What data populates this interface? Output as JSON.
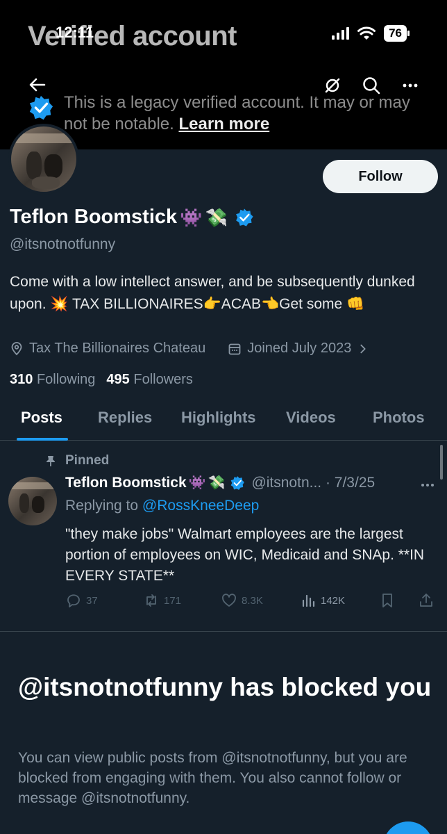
{
  "status_bar": {
    "time": "12:11",
    "battery": "76"
  },
  "header": {
    "ghost_title": "Verified account",
    "legacy_text": "This is a legacy verified account. It may or may not be notable.",
    "learn_more": "Learn more"
  },
  "profile": {
    "follow_label": "Follow",
    "display_name": "Teflon Boomstick",
    "name_emojis": [
      "👾",
      "💸"
    ],
    "handle": "@itsnotnotfunny",
    "bio": "Come with a low intellect answer, and be subsequently dunked upon.  💥 TAX BILLIONAIRES👉ACAB👈Get some 👊",
    "location": "Tax The Billionaires Chateau",
    "joined": "Joined July 2023",
    "following_count": "310",
    "following_label": "Following",
    "followers_count": "495",
    "followers_label": "Followers"
  },
  "tabs": [
    {
      "label": "Posts",
      "active": true
    },
    {
      "label": "Replies"
    },
    {
      "label": "Highlights"
    },
    {
      "label": "Videos"
    },
    {
      "label": "Photos"
    }
  ],
  "post": {
    "pinned_label": "Pinned",
    "author_name": "Teflon Boomstick",
    "handle_date": "@itsnotn... · 7/3/25",
    "replying_prefix": "Replying to",
    "replying_to": "@RossKneeDeep",
    "text": "\"they make jobs\" Walmart employees are the largest portion of employees on WIC, Medicaid and SNAp. **IN EVERY STATE**",
    "replies": "37",
    "reposts": "171",
    "likes": "8.3K",
    "views": "142K"
  },
  "blocked": {
    "title": "@itsnotnotfunny has blocked you",
    "text": "You can view public posts from @itsnotnotfunny, but you are blocked from engaging with them. You also cannot follow or message @itsnotnotfunny."
  },
  "colors": {
    "accent": "#1d9bf0",
    "background": "#15202b",
    "muted": "#8b98a5"
  }
}
